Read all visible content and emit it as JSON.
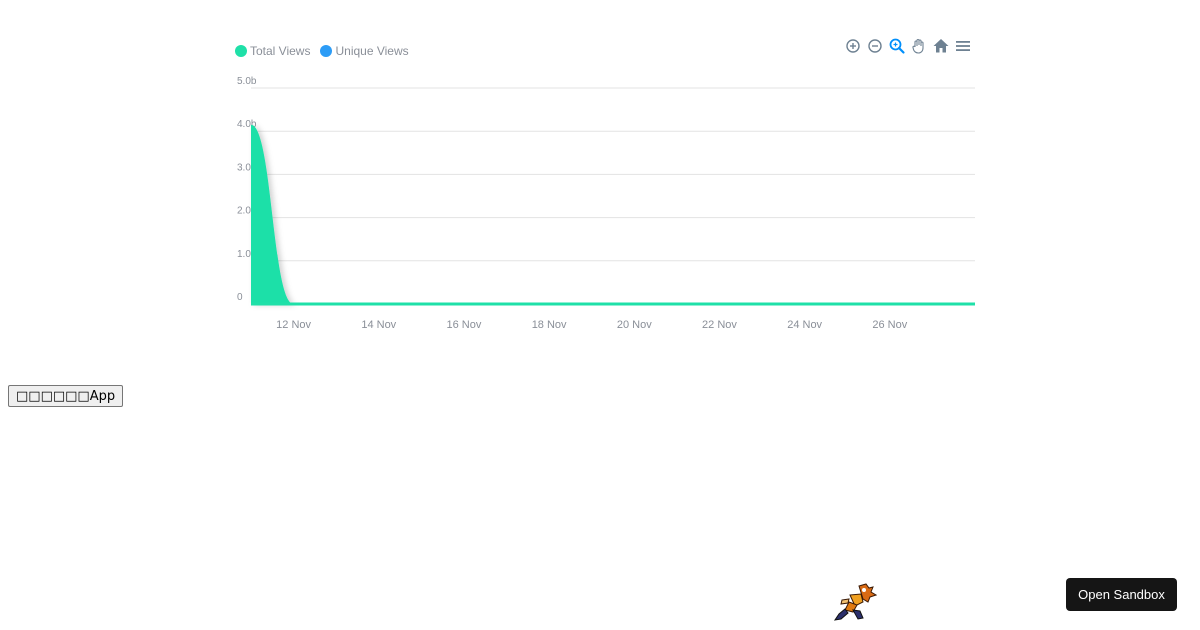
{
  "legend": [
    {
      "label": "Total Views",
      "color": "#1fe0a8"
    },
    {
      "label": "Unique Views",
      "color": "#2c9cf6"
    }
  ],
  "toolbar": {
    "icons": [
      "zoom-in-icon",
      "zoom-out-icon",
      "selection-zoom-icon",
      "pan-hand-icon",
      "home-reset-icon",
      "menu-icon"
    ],
    "icon_color": "#6e8192",
    "active_color": "#008ffb"
  },
  "chart_data": {
    "type": "area",
    "title": "",
    "xlabel": "",
    "ylabel": "",
    "ylim": [
      0,
      5.0
    ],
    "y_ticks": [
      "0",
      "1.0b",
      "2.0b",
      "3.0b",
      "4.0b",
      "5.0b"
    ],
    "x_ticks": [
      "12 Nov",
      "14 Nov",
      "16 Nov",
      "18 Nov",
      "20 Nov",
      "22 Nov",
      "24 Nov",
      "26 Nov"
    ],
    "x_range": [
      "2023-11-11",
      "2023-11-28"
    ],
    "grid": true,
    "legend_position": "top-left",
    "series": [
      {
        "name": "Total Views",
        "color": "#1fe0a8",
        "x": [
          "2023-11-11",
          "2023-11-12",
          "2023-11-13",
          "2023-11-14",
          "2023-11-15",
          "2023-11-16",
          "2023-11-17",
          "2023-11-18",
          "2023-11-19",
          "2023-11-20",
          "2023-11-21",
          "2023-11-22",
          "2023-11-23",
          "2023-11-24",
          "2023-11-25",
          "2023-11-26",
          "2023-11-27",
          "2023-11-28"
        ],
        "values": [
          4.15,
          0,
          0,
          0,
          0,
          0,
          0,
          0,
          0,
          0,
          0,
          0,
          0,
          0,
          0,
          0,
          0,
          0
        ]
      },
      {
        "name": "Unique Views",
        "color": "#2c9cf6",
        "x": [
          "2023-11-11",
          "2023-11-28"
        ],
        "values": [
          0,
          0
        ]
      }
    ]
  },
  "app_button": {
    "label": "□□□□□□App"
  },
  "sandbox_button": {
    "label": "Open Sandbox"
  }
}
